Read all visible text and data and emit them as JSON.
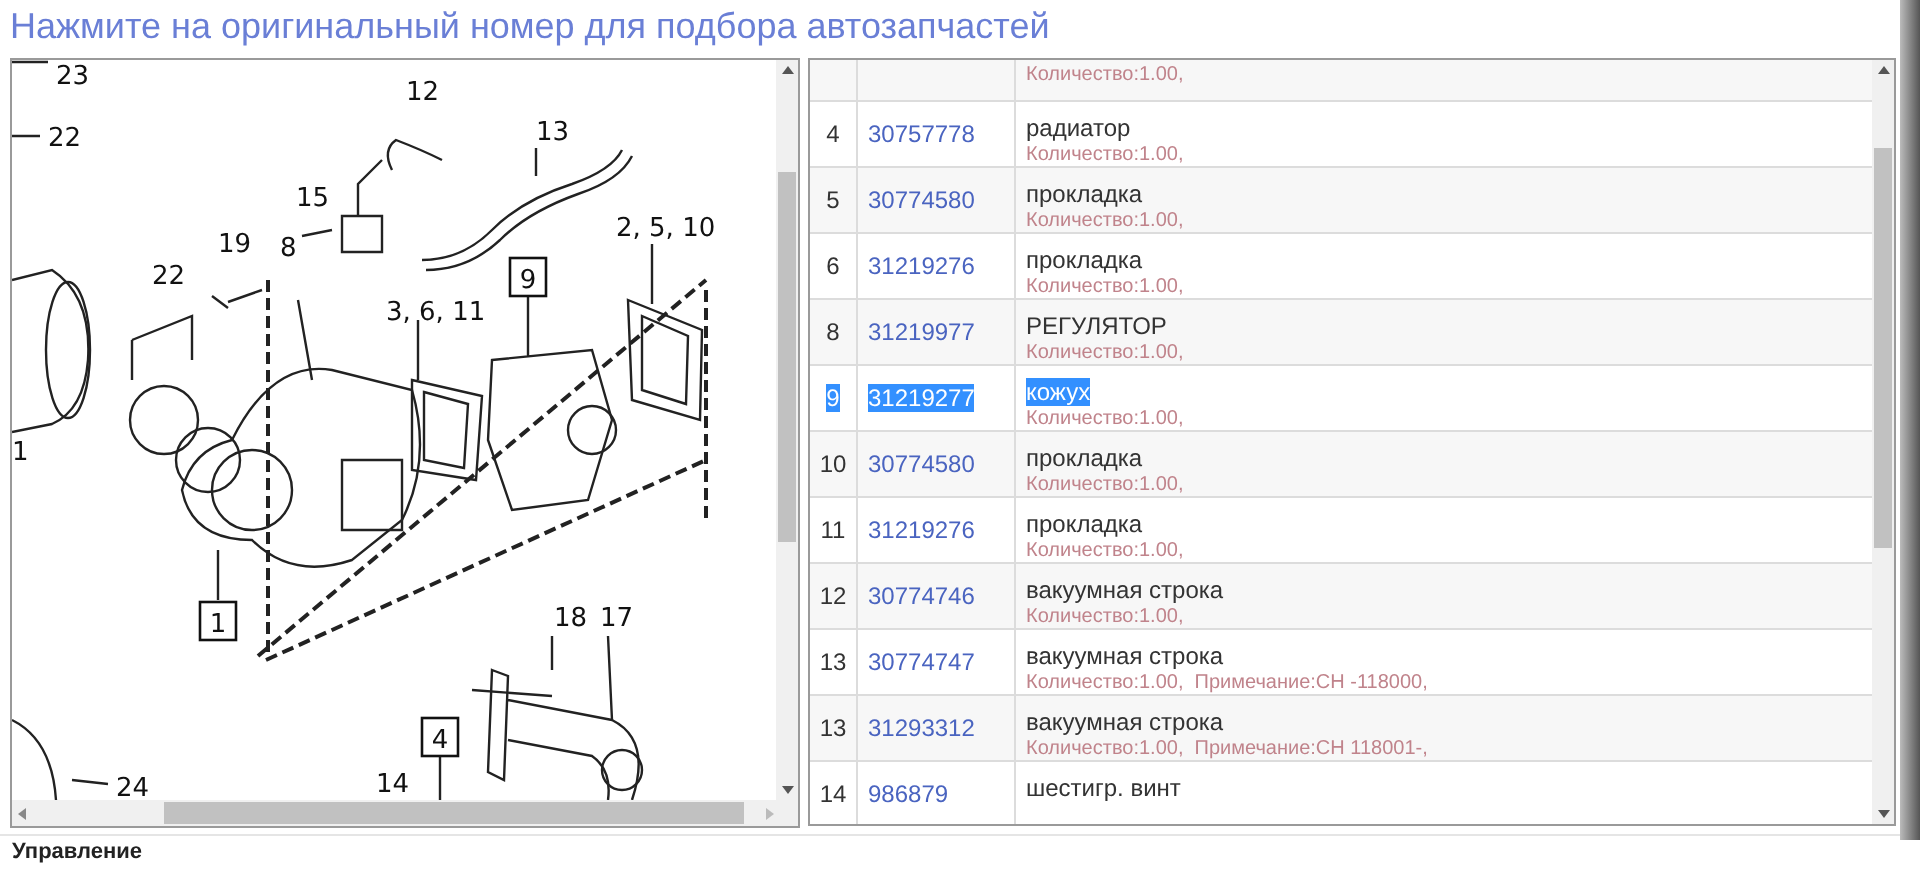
{
  "title": "Нажмите на оригинальный номер для подбора автозапчастей",
  "diagram": {
    "callouts": [
      {
        "text": "23",
        "boxed": false
      },
      {
        "text": "22",
        "boxed": false
      },
      {
        "text": "12",
        "boxed": false
      },
      {
        "text": "13",
        "boxed": false
      },
      {
        "text": "15",
        "boxed": false
      },
      {
        "text": "8",
        "boxed": false
      },
      {
        "text": "19",
        "boxed": false
      },
      {
        "text": "22",
        "boxed": false
      },
      {
        "text": "2, 5, 10",
        "boxed": false
      },
      {
        "text": "9",
        "boxed": true
      },
      {
        "text": "3, 6, 11",
        "boxed": false
      },
      {
        "text": "1",
        "boxed": false
      },
      {
        "text": "1",
        "boxed": true
      },
      {
        "text": "18",
        "boxed": false
      },
      {
        "text": "17",
        "boxed": false
      },
      {
        "text": "4",
        "boxed": true
      },
      {
        "text": "14",
        "boxed": false
      },
      {
        "text": "24",
        "boxed": false
      }
    ]
  },
  "parts": [
    {
      "details": "Количество:1.00,"
    },
    {
      "number": "4",
      "part_no": "30757778",
      "name": "радиатор",
      "details": "Количество:1.00,",
      "selected": false
    },
    {
      "number": "5",
      "part_no": "30774580",
      "name": "прокладка",
      "details": "Количество:1.00,",
      "selected": false
    },
    {
      "number": "6",
      "part_no": "31219276",
      "name": "прокладка",
      "details": "Количество:1.00,",
      "selected": false
    },
    {
      "number": "8",
      "part_no": "31219977",
      "name": "РЕГУЛЯТОР",
      "details": "Количество:1.00,",
      "selected": false
    },
    {
      "number": "9",
      "part_no": "31219277",
      "name": "кожух",
      "details": "Количество:1.00,",
      "selected": true
    },
    {
      "number": "10",
      "part_no": "30774580",
      "name": "прокладка",
      "details": "Количество:1.00,",
      "selected": false
    },
    {
      "number": "11",
      "part_no": "31219276",
      "name": "прокладка",
      "details": "Количество:1.00,",
      "selected": false
    },
    {
      "number": "12",
      "part_no": "30774746",
      "name": "вакуумная строка",
      "details": "Количество:1.00,",
      "selected": false
    },
    {
      "number": "13",
      "part_no": "30774747",
      "name": "вакуумная строка",
      "details": "Количество:1.00,  Примечание:CH -118000,",
      "selected": false
    },
    {
      "number": "13",
      "part_no": "31293312",
      "name": "вакуумная строка",
      "details": "Количество:1.00,  Примечание:CH 118001-,",
      "selected": false
    },
    {
      "number": "14",
      "part_no": "986879",
      "name": "шестигр. винт",
      "selected": false
    }
  ],
  "footer": {
    "label": "Управление"
  }
}
